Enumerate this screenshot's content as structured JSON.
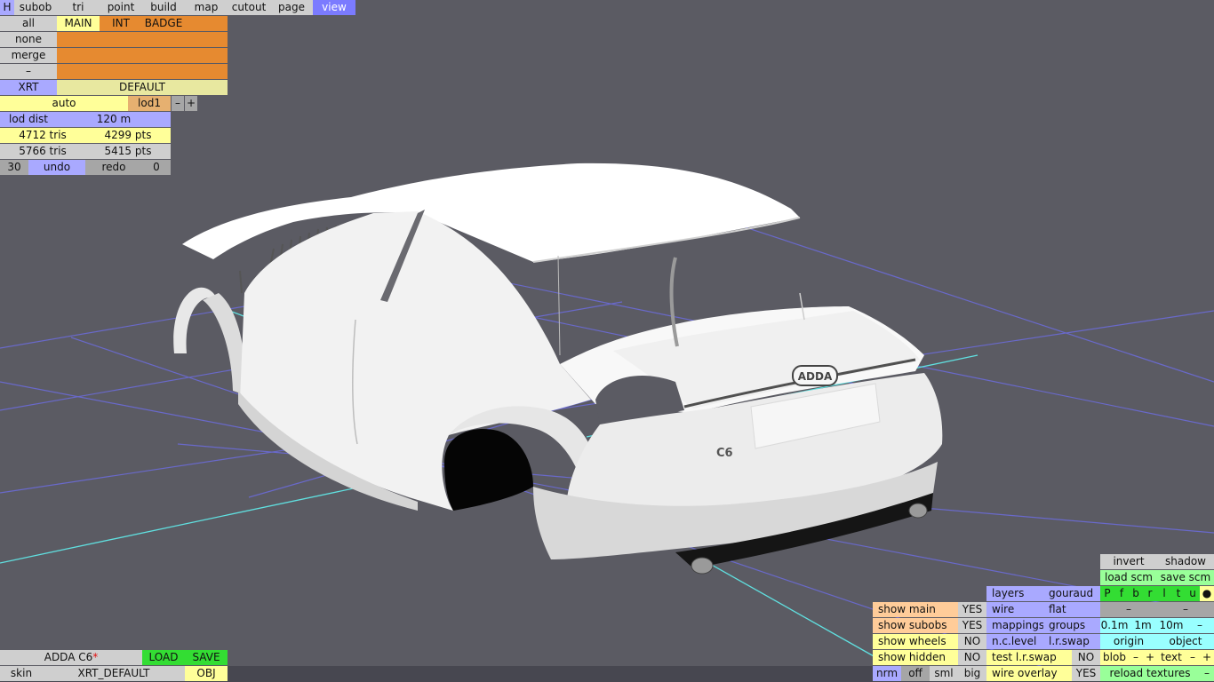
{
  "menu": {
    "h": "H",
    "tabs": [
      "subob",
      "tri",
      "point",
      "build",
      "map",
      "cutout",
      "page",
      "view"
    ],
    "active": "view"
  },
  "groups": {
    "all": "all",
    "none": "none",
    "merge": "merge",
    "dash": "–",
    "headers": [
      "MAIN",
      "INT",
      "BADGE"
    ]
  },
  "variant": {
    "xrt": "XRT",
    "default": "DEFAULT"
  },
  "lod": {
    "auto": "auto",
    "name": "lod1",
    "minus": "–",
    "plus": "+",
    "dist_label": "lod dist",
    "dist_value": "120 m"
  },
  "stats": {
    "tris1": "4712 tris",
    "pts1": "4299 pts",
    "tris2": "5766 tris",
    "pts2": "5415 pts"
  },
  "undo": {
    "count": "30",
    "undo": "undo",
    "redo": "redo",
    "redo_count": "0"
  },
  "model": {
    "title": "ADDA C6",
    "modified": "*",
    "load": "LOAD",
    "save": "SAVE",
    "skin": "skin",
    "skin_name": "XRT_DEFAULT",
    "obj": "OBJ",
    "badge_text": "ADDA",
    "trunk_text": "C6"
  },
  "right_panel": {
    "invert": "invert",
    "shadow": "shadow",
    "load_scm": "load scm",
    "save_scm": "save scm",
    "layers": "layers",
    "gouraud": "gouraud",
    "layer_toggles": [
      "P",
      "f",
      "b",
      "r",
      "l",
      "t",
      "u",
      "●"
    ],
    "wire": "wire",
    "flat": "flat",
    "dash": "–",
    "mappings": "mappings",
    "groups": "groups",
    "grid": [
      "0.1m",
      "1m",
      "10m",
      "–"
    ],
    "nc_level": "n.c.level",
    "lr_swap": "l.r.swap",
    "origin": "origin",
    "object": "object",
    "test_lr_swap": "test l.r.swap",
    "test_lr_swap_value": "NO",
    "blob": "blob",
    "text": "text",
    "minus": "–",
    "plus": "+",
    "wire_overlay": "wire overlay",
    "wire_overlay_value": "YES",
    "reload_textures": "reload textures",
    "nrm": "nrm",
    "off": "off",
    "sml": "sml",
    "big": "big"
  },
  "show_panel": [
    {
      "label": "show main",
      "value": "YES"
    },
    {
      "label": "show subobs",
      "value": "YES"
    },
    {
      "label": "show wheels",
      "value": "NO"
    },
    {
      "label": "show hidden",
      "value": "NO"
    }
  ]
}
